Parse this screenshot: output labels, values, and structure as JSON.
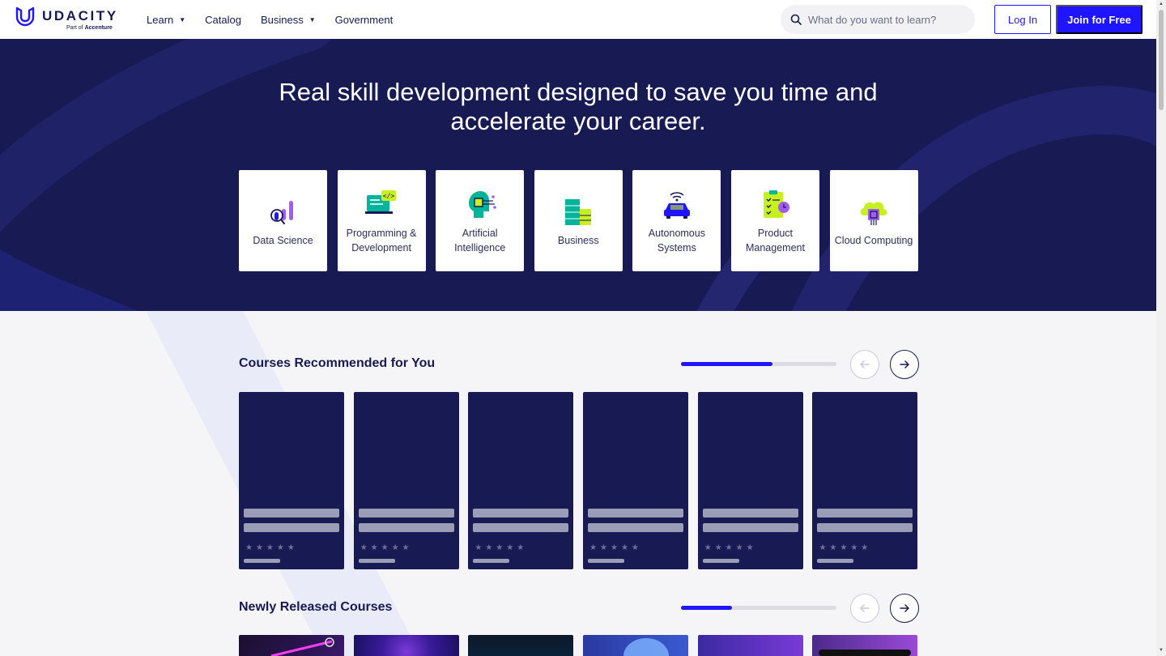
{
  "header": {
    "logo_word": "UDACITY",
    "logo_sub_prefix": "Part of ",
    "logo_sub_brand": "Accenture",
    "nav": [
      {
        "label": "Learn",
        "dropdown": true
      },
      {
        "label": "Catalog",
        "dropdown": false
      },
      {
        "label": "Business",
        "dropdown": true
      },
      {
        "label": "Government",
        "dropdown": false
      }
    ],
    "search_placeholder": "What do you want to learn?",
    "login_label": "Log In",
    "join_label": "Join for Free"
  },
  "hero": {
    "title": "Real skill development designed to save you time and accelerate your career.",
    "categories": [
      {
        "label": "Data Science",
        "icon": "data-science-icon"
      },
      {
        "label": "Programming & Development",
        "icon": "programming-icon"
      },
      {
        "label": "Artificial Intelligence",
        "icon": "ai-icon"
      },
      {
        "label": "Business",
        "icon": "business-icon"
      },
      {
        "label": "Autonomous Systems",
        "icon": "autonomous-icon"
      },
      {
        "label": "Product Management",
        "icon": "product-management-icon"
      },
      {
        "label": "Cloud Computing",
        "icon": "cloud-icon"
      }
    ]
  },
  "sections": [
    {
      "title": "Courses Recommended for You",
      "carousel_progress": 0.59
    },
    {
      "title": "Newly Released Courses",
      "carousel_progress": 0.33
    }
  ],
  "colors": {
    "brand_blue": "#2015ff",
    "navy": "#171a53",
    "page_bg": "#f5f5f7"
  }
}
